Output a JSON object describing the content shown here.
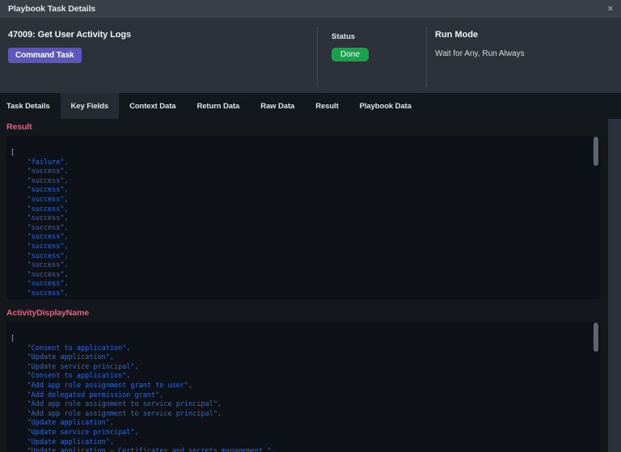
{
  "titlebar": {
    "title": "Playbook Task Details",
    "close_icon": "×"
  },
  "header": {
    "task_title": "47009: Get User Activity Logs",
    "task_type_badge": "Command Task",
    "status_label": "Status",
    "status_value": "Done",
    "run_mode_label": "Run Mode",
    "run_mode_value": "Wait for Any, Run Always"
  },
  "tabs": [
    {
      "label": "Task Details",
      "active": false
    },
    {
      "label": "Key Fields",
      "active": true
    },
    {
      "label": "Context Data",
      "active": false
    },
    {
      "label": "Return Data",
      "active": false
    },
    {
      "label": "Raw Data",
      "active": false
    },
    {
      "label": "Result",
      "active": false
    },
    {
      "label": "Playbook Data",
      "active": false
    }
  ],
  "sections": [
    {
      "title": "Result",
      "lines": [
        "[",
        "    \"failure\",",
        "    \"success\",",
        "    \"success\",",
        "    \"success\",",
        "    \"success\",",
        "    \"success\",",
        "    \"success\",",
        "    \"success\",",
        "    \"success\",",
        "    \"success\",",
        "    \"success\",",
        "    \"success\",",
        "    \"success\",",
        "    \"success\",",
        "    \"success\","
      ]
    },
    {
      "title": "ActivityDisplayName",
      "lines": [
        "[",
        "    \"Consent to application\",",
        "    \"Update application\",",
        "    \"Update service principal\",",
        "    \"Consent to application\",",
        "    \"Add app role assignment grant to user\",",
        "    \"Add delegated permission grant\",",
        "    \"Add app role assignment to service principal\",",
        "    \"Add app role assignment to service principal\",",
        "    \"Update application\",",
        "    \"Update service principal\",",
        "    \"Update application\",",
        "    \"Update application – Certificates and secrets management \","
      ]
    }
  ],
  "colors": {
    "badge_purple": "#6055bf",
    "status_green": "#17a24b",
    "section_header_pink": "#ee5c7f",
    "code_string_blue": "#2d6bdb"
  }
}
